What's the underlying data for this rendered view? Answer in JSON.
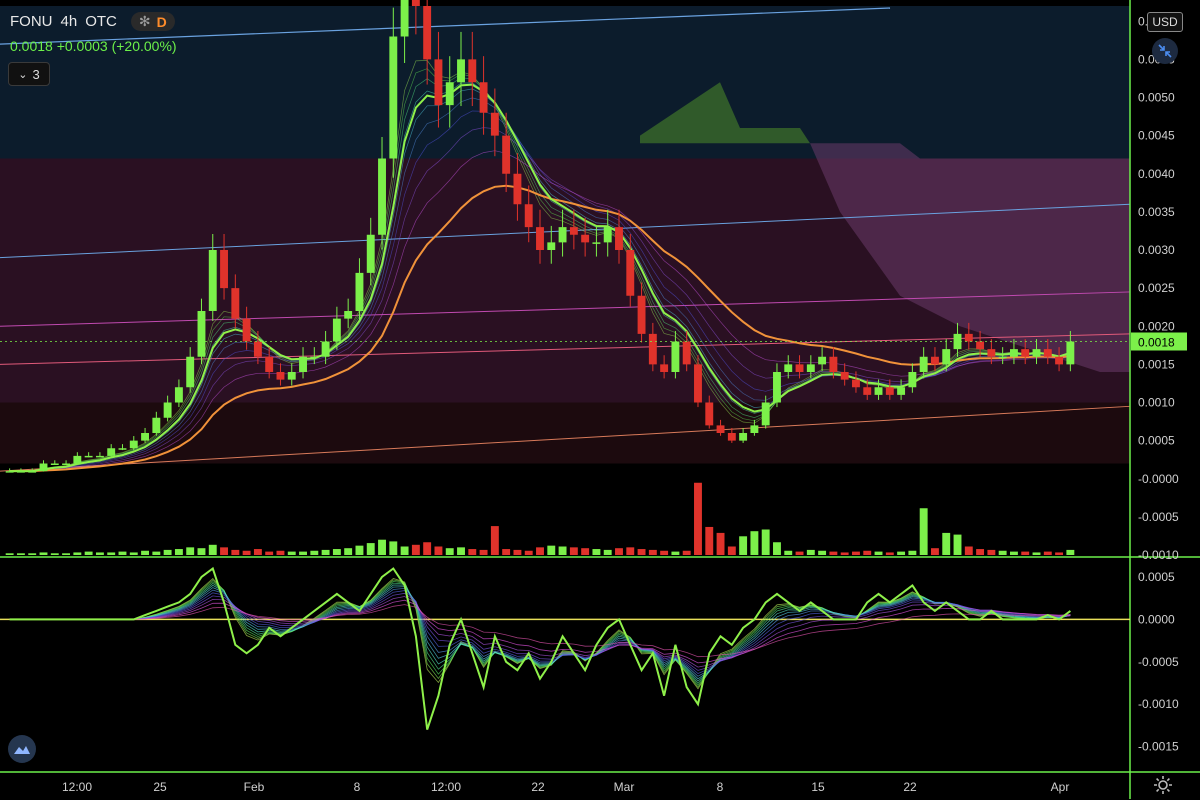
{
  "header": {
    "symbol": "FONU",
    "timeframe": "4h",
    "exchange": "OTC",
    "star_icon": "asterisk-icon",
    "badge_letter": "D",
    "price_change": "0.0018  +0.0003 (+20.00%)",
    "indicator_count": "3"
  },
  "controls": {
    "currency": "USD"
  },
  "colors": {
    "up": "#7cf04a",
    "down": "#e0332b",
    "ema_orange": "#f0923a",
    "ema_green": "#8ff04a",
    "axis_text": "#d0d0d0",
    "border": "#6cf04a"
  },
  "chart_data": [
    {
      "type": "candlestick",
      "panel": "price",
      "y_ticks": [
        "0.0060",
        "0.0055",
        "0.0050",
        "0.0045",
        "0.0040",
        "0.0035",
        "0.0030",
        "0.0025",
        "0.0020",
        "0.0015",
        "0.0010",
        "0.0005",
        "-0.0000",
        "-0.0005",
        "-0.0010"
      ],
      "x_ticks": [
        "12:00",
        "25",
        "Feb",
        "8",
        "12:00",
        "22",
        "Mar",
        "8",
        "15",
        "22",
        "Apr"
      ],
      "last_price_label": "0.0018",
      "ylim": [
        -0.001,
        0.0062
      ],
      "close": [
        0.0001,
        0.0001,
        0.0001,
        0.0002,
        0.0002,
        0.0002,
        0.0003,
        0.0003,
        0.0003,
        0.0004,
        0.0004,
        0.0005,
        0.0006,
        0.0008,
        0.001,
        0.0012,
        0.0016,
        0.0022,
        0.003,
        0.0025,
        0.0021,
        0.0018,
        0.0016,
        0.0014,
        0.0013,
        0.0014,
        0.0016,
        0.0016,
        0.0018,
        0.0021,
        0.0022,
        0.0027,
        0.0032,
        0.0042,
        0.0058,
        0.007,
        0.0062,
        0.0055,
        0.0049,
        0.0052,
        0.0055,
        0.0052,
        0.0048,
        0.0045,
        0.004,
        0.0036,
        0.0033,
        0.003,
        0.0031,
        0.0033,
        0.0032,
        0.0031,
        0.0031,
        0.0033,
        0.003,
        0.0024,
        0.0019,
        0.0015,
        0.0014,
        0.0018,
        0.0015,
        0.001,
        0.0007,
        0.0006,
        0.0005,
        0.0006,
        0.0007,
        0.001,
        0.0014,
        0.0015,
        0.0014,
        0.0015,
        0.0016,
        0.0014,
        0.0013,
        0.0012,
        0.0011,
        0.0012,
        0.0011,
        0.0012,
        0.0014,
        0.0016,
        0.0015,
        0.0017,
        0.0019,
        0.0018,
        0.0017,
        0.0016,
        0.0016,
        0.0017,
        0.0016,
        0.0017,
        0.0016,
        0.0015,
        0.0018
      ],
      "volume": [
        0.02,
        0.02,
        0.02,
        0.03,
        0.02,
        0.02,
        0.03,
        0.04,
        0.03,
        0.03,
        0.04,
        0.03,
        0.05,
        0.04,
        0.06,
        0.07,
        0.09,
        0.08,
        0.12,
        0.09,
        0.06,
        0.05,
        0.07,
        0.04,
        0.05,
        0.04,
        0.04,
        0.05,
        0.06,
        0.07,
        0.08,
        0.11,
        0.14,
        0.18,
        0.16,
        0.1,
        0.12,
        0.15,
        0.1,
        0.08,
        0.09,
        0.07,
        0.06,
        0.34,
        0.07,
        0.06,
        0.05,
        0.09,
        0.11,
        0.1,
        0.09,
        0.08,
        0.07,
        0.06,
        0.08,
        0.09,
        0.07,
        0.06,
        0.05,
        0.04,
        0.05,
        0.85,
        0.33,
        0.26,
        0.1,
        0.22,
        0.28,
        0.3,
        0.15,
        0.05,
        0.04,
        0.06,
        0.05,
        0.04,
        0.03,
        0.04,
        0.05,
        0.04,
        0.03,
        0.04,
        0.05,
        0.55,
        0.08,
        0.26,
        0.24,
        0.1,
        0.07,
        0.06,
        0.05,
        0.04,
        0.04,
        0.03,
        0.04,
        0.03,
        0.06
      ]
    },
    {
      "type": "line",
      "panel": "oscillator",
      "y_ticks": [
        "0.0005",
        "0.0000",
        "-0.0005",
        "-0.0010",
        "-0.0015"
      ],
      "ylim": [
        -0.0018,
        0.0007
      ],
      "values": [
        0.0,
        0.0,
        0.0,
        0.0,
        0.0,
        0.0,
        0.0,
        0.0,
        0.0,
        0.0,
        0.0,
        0.0,
        5e-05,
        0.0001,
        0.00015,
        0.0002,
        0.0003,
        0.0005,
        0.0006,
        0.0002,
        -0.0003,
        -0.0004,
        -0.0003,
        -0.0001,
        -0.0002,
        -0.0001,
        0.0,
        0.0001,
        0.0002,
        0.0003,
        0.0002,
        0.0001,
        0.0003,
        0.0005,
        0.0006,
        0.0004,
        -0.0002,
        -0.0013,
        -0.0009,
        -0.0003,
        0.0,
        -0.0004,
        -0.0008,
        -0.0002,
        -0.0005,
        -0.0006,
        -0.0004,
        -0.0007,
        -0.0005,
        -0.0002,
        -0.0004,
        -0.0006,
        -0.0003,
        -0.0001,
        0.0,
        -0.0003,
        -0.0006,
        -0.0004,
        -0.0009,
        -0.0003,
        -0.0008,
        -0.001,
        -0.0004,
        -0.0002,
        -0.0003,
        -0.0001,
        0.0,
        0.0002,
        0.0003,
        0.0002,
        0.0001,
        0.0002,
        0.0001,
        0.0,
        0.0,
        0.0,
        0.0002,
        0.0003,
        0.0002,
        0.0003,
        0.0004,
        0.0002,
        0.0001,
        0.0002,
        0.0001,
        0.0,
        0.0,
        0.0001,
        0.0,
        0.0,
        0.0,
        0.0,
        5e-05,
        0.0,
        0.0001
      ]
    }
  ]
}
